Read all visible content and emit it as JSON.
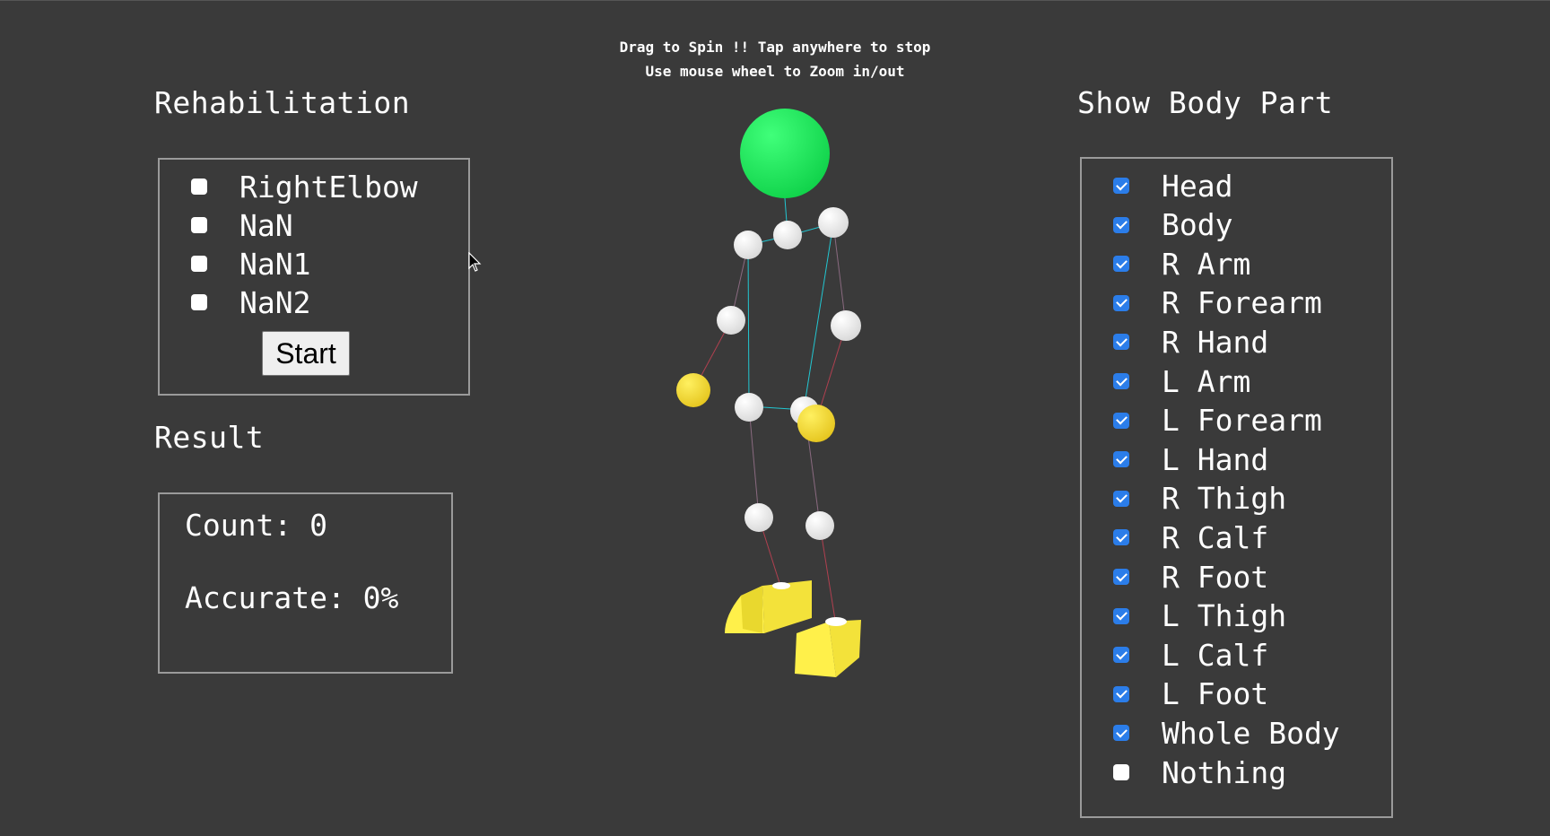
{
  "hint": {
    "line1": "Drag to Spin !! Tap anywhere to stop",
    "line2": "Use mouse wheel to Zoom in/out"
  },
  "rehab": {
    "title": "Rehabilitation",
    "options": [
      {
        "label": "RightElbow",
        "checked": false
      },
      {
        "label": "NaN",
        "checked": false
      },
      {
        "label": "NaN1",
        "checked": false
      },
      {
        "label": "NaN2",
        "checked": false
      }
    ],
    "start_label": "Start"
  },
  "result": {
    "title": "Result",
    "count": "Count: 0",
    "accurate": "Accurate: 0%"
  },
  "body_parts": {
    "title": "Show Body Part",
    "options": [
      {
        "label": "Head",
        "checked": true
      },
      {
        "label": "Body",
        "checked": true
      },
      {
        "label": "R Arm",
        "checked": true
      },
      {
        "label": "R Forearm",
        "checked": true
      },
      {
        "label": "R Hand",
        "checked": true
      },
      {
        "label": "L Arm",
        "checked": true
      },
      {
        "label": "L Forearm",
        "checked": true
      },
      {
        "label": "L Hand",
        "checked": true
      },
      {
        "label": "R Thigh",
        "checked": true
      },
      {
        "label": "R Calf",
        "checked": true
      },
      {
        "label": "R Foot",
        "checked": true
      },
      {
        "label": "L Thigh",
        "checked": true
      },
      {
        "label": "L Calf",
        "checked": true
      },
      {
        "label": "L Foot",
        "checked": true
      },
      {
        "label": "Whole Body",
        "checked": true
      },
      {
        "label": "Nothing",
        "checked": false
      }
    ]
  },
  "colors": {
    "background": "#3a3a3a",
    "head": "#1ee65a",
    "joint": "#ffffff",
    "hand_foot": "#f5e132",
    "checkbox_checked": "#2b7de9",
    "torso_line": "#22c7d2",
    "limb_line": "#b04050"
  }
}
